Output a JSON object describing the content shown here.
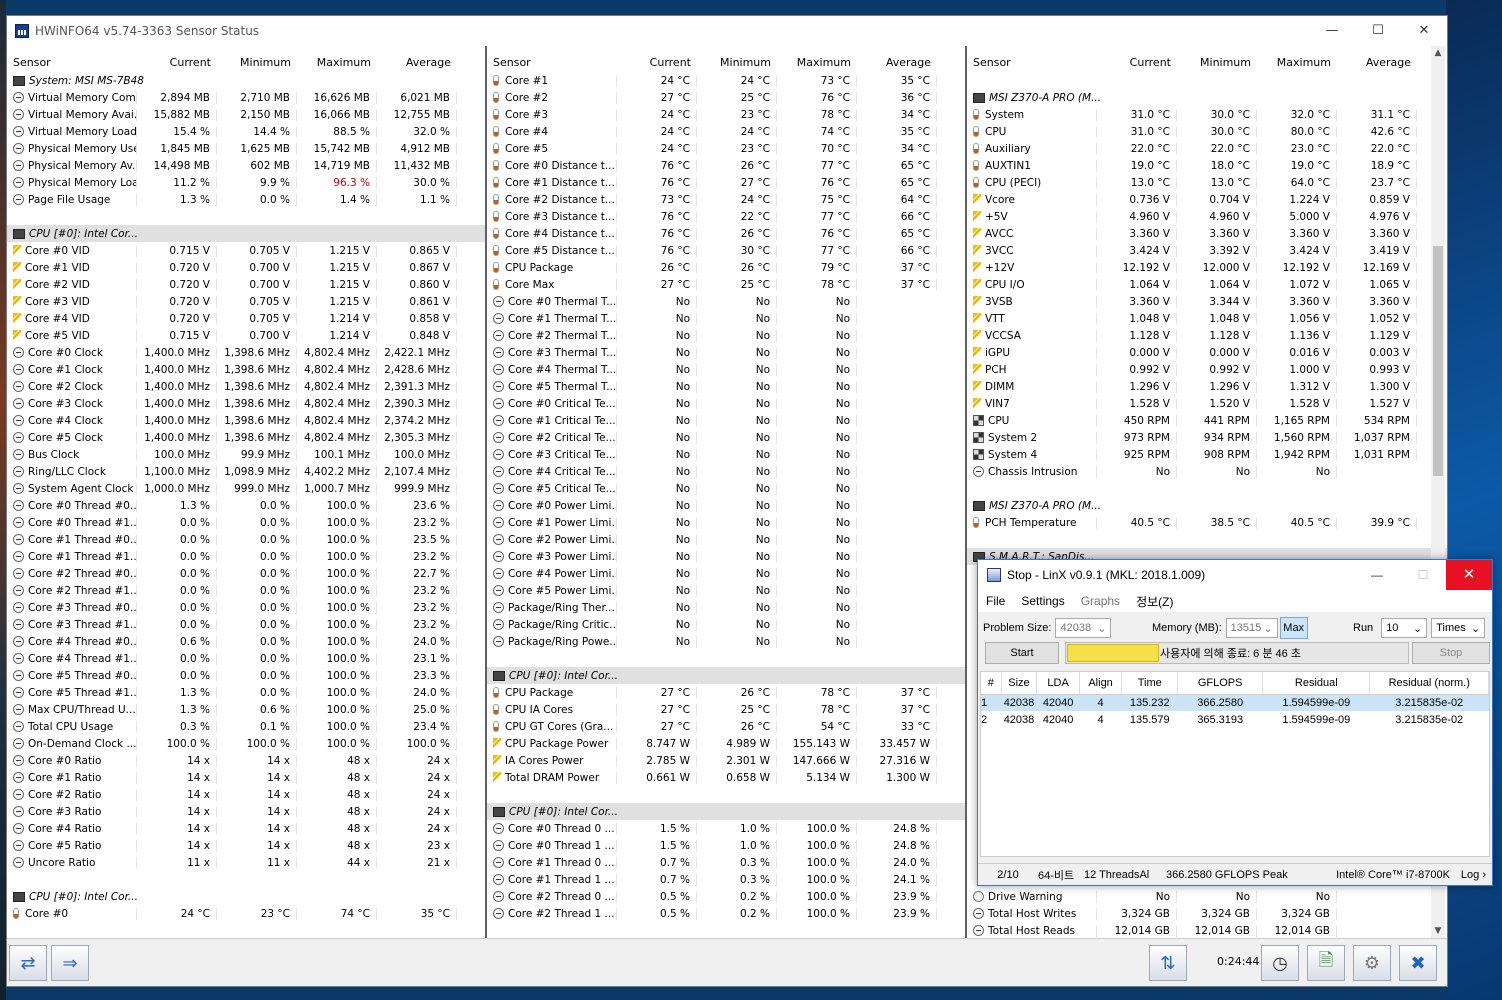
{
  "window": {
    "title": "HWiNFO64 v5.74-3363 Sensor Status",
    "timer": "0:24:44"
  },
  "colors": {
    "group_bg": "#e0e0e0",
    "alert_red": "#d00000",
    "linx_close": "#e81123",
    "progress": "#f5e04a"
  },
  "columns": {
    "sensor": "Sensor",
    "current": "Current",
    "minimum": "Minimum",
    "maximum": "Maximum",
    "average": "Average"
  },
  "panel1": [
    {
      "g": "System: MSI MS-7B48"
    },
    {
      "i": "clock",
      "n": "Virtual Memory Com...",
      "c": "2,894 MB",
      "mi": "2,710 MB",
      "ma": "16,626 MB",
      "a": "6,021 MB"
    },
    {
      "i": "clock",
      "n": "Virtual Memory Avai...",
      "c": "15,882 MB",
      "mi": "2,150 MB",
      "ma": "16,066 MB",
      "a": "12,755 MB"
    },
    {
      "i": "clock",
      "n": "Virtual Memory Load",
      "c": "15.4 %",
      "mi": "14.4 %",
      "ma": "88.5 %",
      "a": "32.0 %"
    },
    {
      "i": "clock",
      "n": "Physical Memory Used",
      "c": "1,845 MB",
      "mi": "1,625 MB",
      "ma": "15,742 MB",
      "a": "4,912 MB"
    },
    {
      "i": "clock",
      "n": "Physical Memory Av...",
      "c": "14,498 MB",
      "mi": "602 MB",
      "ma": "14,719 MB",
      "a": "11,432 MB"
    },
    {
      "i": "clock",
      "n": "Physical Memory Load",
      "c": "11.2 %",
      "mi": "9.9 %",
      "ma": "96.3 %",
      "a": "30.0 %",
      "red": true
    },
    {
      "i": "clock",
      "n": "Page File Usage",
      "c": "1.3 %",
      "mi": "0.0 %",
      "ma": "1.4 %",
      "a": "1.1 %"
    },
    {
      "gap": true
    },
    {
      "g": "CPU [#0]: Intel Cor..."
    },
    {
      "i": "volt",
      "n": "Core #0 VID",
      "c": "0.715 V",
      "mi": "0.705 V",
      "ma": "1.215 V",
      "a": "0.865 V"
    },
    {
      "i": "volt",
      "n": "Core #1 VID",
      "c": "0.720 V",
      "mi": "0.700 V",
      "ma": "1.215 V",
      "a": "0.867 V"
    },
    {
      "i": "volt",
      "n": "Core #2 VID",
      "c": "0.720 V",
      "mi": "0.700 V",
      "ma": "1.215 V",
      "a": "0.860 V"
    },
    {
      "i": "volt",
      "n": "Core #3 VID",
      "c": "0.720 V",
      "mi": "0.705 V",
      "ma": "1.215 V",
      "a": "0.861 V"
    },
    {
      "i": "volt",
      "n": "Core #4 VID",
      "c": "0.720 V",
      "mi": "0.705 V",
      "ma": "1.214 V",
      "a": "0.858 V"
    },
    {
      "i": "volt",
      "n": "Core #5 VID",
      "c": "0.715 V",
      "mi": "0.700 V",
      "ma": "1.214 V",
      "a": "0.848 V"
    },
    {
      "i": "clock",
      "n": "Core #0 Clock",
      "c": "1,400.0 MHz",
      "mi": "1,398.6 MHz",
      "ma": "4,802.4 MHz",
      "a": "2,422.1 MHz"
    },
    {
      "i": "clock",
      "n": "Core #1 Clock",
      "c": "1,400.0 MHz",
      "mi": "1,398.6 MHz",
      "ma": "4,802.4 MHz",
      "a": "2,428.6 MHz"
    },
    {
      "i": "clock",
      "n": "Core #2 Clock",
      "c": "1,400.0 MHz",
      "mi": "1,398.6 MHz",
      "ma": "4,802.4 MHz",
      "a": "2,391.3 MHz"
    },
    {
      "i": "clock",
      "n": "Core #3 Clock",
      "c": "1,400.0 MHz",
      "mi": "1,398.6 MHz",
      "ma": "4,802.4 MHz",
      "a": "2,390.3 MHz"
    },
    {
      "i": "clock",
      "n": "Core #4 Clock",
      "c": "1,400.0 MHz",
      "mi": "1,398.6 MHz",
      "ma": "4,802.4 MHz",
      "a": "2,374.2 MHz"
    },
    {
      "i": "clock",
      "n": "Core #5 Clock",
      "c": "1,400.0 MHz",
      "mi": "1,398.6 MHz",
      "ma": "4,802.4 MHz",
      "a": "2,305.3 MHz"
    },
    {
      "i": "clock",
      "n": "Bus Clock",
      "c": "100.0 MHz",
      "mi": "99.9 MHz",
      "ma": "100.1 MHz",
      "a": "100.0 MHz"
    },
    {
      "i": "clock",
      "n": "Ring/LLC Clock",
      "c": "1,100.0 MHz",
      "mi": "1,098.9 MHz",
      "ma": "4,402.2 MHz",
      "a": "2,107.4 MHz"
    },
    {
      "i": "clock",
      "n": "System Agent Clock",
      "c": "1,000.0 MHz",
      "mi": "999.0 MHz",
      "ma": "1,000.7 MHz",
      "a": "999.9 MHz"
    },
    {
      "i": "clock",
      "n": "Core #0 Thread #0...",
      "c": "1.3 %",
      "mi": "0.0 %",
      "ma": "100.0 %",
      "a": "23.6 %"
    },
    {
      "i": "clock",
      "n": "Core #0 Thread #1...",
      "c": "0.0 %",
      "mi": "0.0 %",
      "ma": "100.0 %",
      "a": "23.2 %"
    },
    {
      "i": "clock",
      "n": "Core #1 Thread #0...",
      "c": "0.0 %",
      "mi": "0.0 %",
      "ma": "100.0 %",
      "a": "23.5 %"
    },
    {
      "i": "clock",
      "n": "Core #1 Thread #1...",
      "c": "0.0 %",
      "mi": "0.0 %",
      "ma": "100.0 %",
      "a": "23.2 %"
    },
    {
      "i": "clock",
      "n": "Core #2 Thread #0...",
      "c": "0.0 %",
      "mi": "0.0 %",
      "ma": "100.0 %",
      "a": "22.7 %"
    },
    {
      "i": "clock",
      "n": "Core #2 Thread #1...",
      "c": "0.0 %",
      "mi": "0.0 %",
      "ma": "100.0 %",
      "a": "23.2 %"
    },
    {
      "i": "clock",
      "n": "Core #3 Thread #0...",
      "c": "0.0 %",
      "mi": "0.0 %",
      "ma": "100.0 %",
      "a": "23.2 %"
    },
    {
      "i": "clock",
      "n": "Core #3 Thread #1...",
      "c": "0.0 %",
      "mi": "0.0 %",
      "ma": "100.0 %",
      "a": "23.2 %"
    },
    {
      "i": "clock",
      "n": "Core #4 Thread #0...",
      "c": "0.6 %",
      "mi": "0.0 %",
      "ma": "100.0 %",
      "a": "24.0 %"
    },
    {
      "i": "clock",
      "n": "Core #4 Thread #1...",
      "c": "0.0 %",
      "mi": "0.0 %",
      "ma": "100.0 %",
      "a": "23.1 %"
    },
    {
      "i": "clock",
      "n": "Core #5 Thread #0...",
      "c": "0.0 %",
      "mi": "0.0 %",
      "ma": "100.0 %",
      "a": "23.3 %"
    },
    {
      "i": "clock",
      "n": "Core #5 Thread #1...",
      "c": "1.3 %",
      "mi": "0.0 %",
      "ma": "100.0 %",
      "a": "24.0 %"
    },
    {
      "i": "clock",
      "n": "Max CPU/Thread U...",
      "c": "1.3 %",
      "mi": "0.6 %",
      "ma": "100.0 %",
      "a": "25.0 %"
    },
    {
      "i": "clock",
      "n": "Total CPU Usage",
      "c": "0.3 %",
      "mi": "0.1 %",
      "ma": "100.0 %",
      "a": "23.4 %"
    },
    {
      "i": "clock",
      "n": "On-Demand Clock ...",
      "c": "100.0 %",
      "mi": "100.0 %",
      "ma": "100.0 %",
      "a": "100.0 %"
    },
    {
      "i": "clock",
      "n": "Core #0 Ratio",
      "c": "14 x",
      "mi": "14 x",
      "ma": "48 x",
      "a": "24 x"
    },
    {
      "i": "clock",
      "n": "Core #1 Ratio",
      "c": "14 x",
      "mi": "14 x",
      "ma": "48 x",
      "a": "24 x"
    },
    {
      "i": "clock",
      "n": "Core #2 Ratio",
      "c": "14 x",
      "mi": "14 x",
      "ma": "48 x",
      "a": "24 x"
    },
    {
      "i": "clock",
      "n": "Core #3 Ratio",
      "c": "14 x",
      "mi": "14 x",
      "ma": "48 x",
      "a": "24 x"
    },
    {
      "i": "clock",
      "n": "Core #4 Ratio",
      "c": "14 x",
      "mi": "14 x",
      "ma": "48 x",
      "a": "24 x"
    },
    {
      "i": "clock",
      "n": "Core #5 Ratio",
      "c": "14 x",
      "mi": "14 x",
      "ma": "48 x",
      "a": "23 x"
    },
    {
      "i": "clock",
      "n": "Uncore Ratio",
      "c": "11 x",
      "mi": "11 x",
      "ma": "44 x",
      "a": "21 x"
    },
    {
      "gap": true
    },
    {
      "g": "CPU [#0]: Intel Cor..."
    },
    {
      "i": "temp",
      "n": "Core #0",
      "c": "24 °C",
      "mi": "23 °C",
      "ma": "74 °C",
      "a": "35 °C"
    }
  ],
  "panel2": [
    {
      "i": "temp",
      "n": "Core #1",
      "c": "24 °C",
      "mi": "24 °C",
      "ma": "73 °C",
      "a": "35 °C"
    },
    {
      "i": "temp",
      "n": "Core #2",
      "c": "27 °C",
      "mi": "25 °C",
      "ma": "76 °C",
      "a": "36 °C"
    },
    {
      "i": "temp",
      "n": "Core #3",
      "c": "24 °C",
      "mi": "23 °C",
      "ma": "78 °C",
      "a": "34 °C"
    },
    {
      "i": "temp",
      "n": "Core #4",
      "c": "24 °C",
      "mi": "24 °C",
      "ma": "74 °C",
      "a": "35 °C"
    },
    {
      "i": "temp",
      "n": "Core #5",
      "c": "24 °C",
      "mi": "23 °C",
      "ma": "70 °C",
      "a": "34 °C"
    },
    {
      "i": "temp",
      "n": "Core #0 Distance t...",
      "c": "76 °C",
      "mi": "26 °C",
      "ma": "77 °C",
      "a": "65 °C"
    },
    {
      "i": "temp",
      "n": "Core #1 Distance t...",
      "c": "76 °C",
      "mi": "27 °C",
      "ma": "76 °C",
      "a": "65 °C"
    },
    {
      "i": "temp",
      "n": "Core #2 Distance t...",
      "c": "73 °C",
      "mi": "24 °C",
      "ma": "75 °C",
      "a": "64 °C"
    },
    {
      "i": "temp",
      "n": "Core #3 Distance t...",
      "c": "76 °C",
      "mi": "22 °C",
      "ma": "77 °C",
      "a": "66 °C"
    },
    {
      "i": "temp",
      "n": "Core #4 Distance t...",
      "c": "76 °C",
      "mi": "26 °C",
      "ma": "76 °C",
      "a": "65 °C"
    },
    {
      "i": "temp",
      "n": "Core #5 Distance t...",
      "c": "76 °C",
      "mi": "30 °C",
      "ma": "77 °C",
      "a": "66 °C"
    },
    {
      "i": "temp",
      "n": "CPU Package",
      "c": "26 °C",
      "mi": "26 °C",
      "ma": "79 °C",
      "a": "37 °C"
    },
    {
      "i": "temp",
      "n": "Core Max",
      "c": "27 °C",
      "mi": "25 °C",
      "ma": "78 °C",
      "a": "37 °C"
    },
    {
      "i": "clock",
      "n": "Core #0 Thermal T...",
      "c": "No",
      "mi": "No",
      "ma": "No",
      "a": ""
    },
    {
      "i": "clock",
      "n": "Core #1 Thermal T...",
      "c": "No",
      "mi": "No",
      "ma": "No",
      "a": ""
    },
    {
      "i": "clock",
      "n": "Core #2 Thermal T...",
      "c": "No",
      "mi": "No",
      "ma": "No",
      "a": ""
    },
    {
      "i": "clock",
      "n": "Core #3 Thermal T...",
      "c": "No",
      "mi": "No",
      "ma": "No",
      "a": ""
    },
    {
      "i": "clock",
      "n": "Core #4 Thermal T...",
      "c": "No",
      "mi": "No",
      "ma": "No",
      "a": ""
    },
    {
      "i": "clock",
      "n": "Core #5 Thermal T...",
      "c": "No",
      "mi": "No",
      "ma": "No",
      "a": ""
    },
    {
      "i": "clock",
      "n": "Core #0 Critical Te...",
      "c": "No",
      "mi": "No",
      "ma": "No",
      "a": ""
    },
    {
      "i": "clock",
      "n": "Core #1 Critical Te...",
      "c": "No",
      "mi": "No",
      "ma": "No",
      "a": ""
    },
    {
      "i": "clock",
      "n": "Core #2 Critical Te...",
      "c": "No",
      "mi": "No",
      "ma": "No",
      "a": ""
    },
    {
      "i": "clock",
      "n": "Core #3 Critical Te...",
      "c": "No",
      "mi": "No",
      "ma": "No",
      "a": ""
    },
    {
      "i": "clock",
      "n": "Core #4 Critical Te...",
      "c": "No",
      "mi": "No",
      "ma": "No",
      "a": ""
    },
    {
      "i": "clock",
      "n": "Core #5 Critical Te...",
      "c": "No",
      "mi": "No",
      "ma": "No",
      "a": ""
    },
    {
      "i": "clock",
      "n": "Core #0 Power Limi...",
      "c": "No",
      "mi": "No",
      "ma": "No",
      "a": ""
    },
    {
      "i": "clock",
      "n": "Core #1 Power Limi...",
      "c": "No",
      "mi": "No",
      "ma": "No",
      "a": ""
    },
    {
      "i": "clock",
      "n": "Core #2 Power Limi...",
      "c": "No",
      "mi": "No",
      "ma": "No",
      "a": ""
    },
    {
      "i": "clock",
      "n": "Core #3 Power Limi...",
      "c": "No",
      "mi": "No",
      "ma": "No",
      "a": ""
    },
    {
      "i": "clock",
      "n": "Core #4 Power Limi...",
      "c": "No",
      "mi": "No",
      "ma": "No",
      "a": ""
    },
    {
      "i": "clock",
      "n": "Core #5 Power Limi...",
      "c": "No",
      "mi": "No",
      "ma": "No",
      "a": ""
    },
    {
      "i": "clock",
      "n": "Package/Ring Ther...",
      "c": "No",
      "mi": "No",
      "ma": "No",
      "a": ""
    },
    {
      "i": "clock",
      "n": "Package/Ring Critic...",
      "c": "No",
      "mi": "No",
      "ma": "No",
      "a": ""
    },
    {
      "i": "clock",
      "n": "Package/Ring Powe...",
      "c": "No",
      "mi": "No",
      "ma": "No",
      "a": ""
    },
    {
      "gap": true
    },
    {
      "g": "CPU [#0]: Intel Cor..."
    },
    {
      "i": "temp",
      "n": "CPU Package",
      "c": "27 °C",
      "mi": "26 °C",
      "ma": "78 °C",
      "a": "37 °C"
    },
    {
      "i": "temp",
      "n": "CPU IA Cores",
      "c": "27 °C",
      "mi": "25 °C",
      "ma": "78 °C",
      "a": "37 °C"
    },
    {
      "i": "temp",
      "n": "CPU GT Cores (Gra...",
      "c": "27 °C",
      "mi": "26 °C",
      "ma": "54 °C",
      "a": "33 °C"
    },
    {
      "i": "volt",
      "n": "CPU Package Power",
      "c": "8.747 W",
      "mi": "4.989 W",
      "ma": "155.143 W",
      "a": "33.457 W"
    },
    {
      "i": "volt",
      "n": "IA Cores Power",
      "c": "2.785 W",
      "mi": "2.301 W",
      "ma": "147.666 W",
      "a": "27.316 W"
    },
    {
      "i": "volt",
      "n": "Total DRAM Power",
      "c": "0.661 W",
      "mi": "0.658 W",
      "ma": "5.134 W",
      "a": "1.300 W"
    },
    {
      "gap": true
    },
    {
      "g": "CPU [#0]: Intel Cor..."
    },
    {
      "i": "clock",
      "n": "Core #0 Thread 0 ...",
      "c": "1.5 %",
      "mi": "1.0 %",
      "ma": "100.0 %",
      "a": "24.8 %"
    },
    {
      "i": "clock",
      "n": "Core #0 Thread 1 ...",
      "c": "1.5 %",
      "mi": "1.0 %",
      "ma": "100.0 %",
      "a": "24.8 %"
    },
    {
      "i": "clock",
      "n": "Core #1 Thread 0 ...",
      "c": "0.7 %",
      "mi": "0.3 %",
      "ma": "100.0 %",
      "a": "24.0 %"
    },
    {
      "i": "clock",
      "n": "Core #1 Thread 1 ...",
      "c": "0.7 %",
      "mi": "0.3 %",
      "ma": "100.0 %",
      "a": "24.1 %"
    },
    {
      "i": "clock",
      "n": "Core #2 Thread 0 ...",
      "c": "0.5 %",
      "mi": "0.2 %",
      "ma": "100.0 %",
      "a": "23.9 %"
    },
    {
      "i": "clock",
      "n": "Core #2 Thread 1 ...",
      "c": "0.5 %",
      "mi": "0.2 %",
      "ma": "100.0 %",
      "a": "23.9 %"
    }
  ],
  "panel3": [
    {
      "gap": true
    },
    {
      "g": "MSI Z370-A PRO (M..."
    },
    {
      "i": "temp",
      "n": "System",
      "c": "31.0 °C",
      "mi": "30.0 °C",
      "ma": "32.0 °C",
      "a": "31.1 °C"
    },
    {
      "i": "temp",
      "n": "CPU",
      "c": "31.0 °C",
      "mi": "30.0 °C",
      "ma": "80.0 °C",
      "a": "42.6 °C"
    },
    {
      "i": "temp",
      "n": "Auxiliary",
      "c": "22.0 °C",
      "mi": "22.0 °C",
      "ma": "23.0 °C",
      "a": "22.0 °C"
    },
    {
      "i": "temp",
      "n": "AUXTIN1",
      "c": "19.0 °C",
      "mi": "18.0 °C",
      "ma": "19.0 °C",
      "a": "18.9 °C"
    },
    {
      "i": "temp",
      "n": "CPU (PECI)",
      "c": "13.0 °C",
      "mi": "13.0 °C",
      "ma": "64.0 °C",
      "a": "23.7 °C"
    },
    {
      "i": "volt",
      "n": "Vcore",
      "c": "0.736 V",
      "mi": "0.704 V",
      "ma": "1.224 V",
      "a": "0.859 V"
    },
    {
      "i": "volt",
      "n": "+5V",
      "c": "4.960 V",
      "mi": "4.960 V",
      "ma": "5.000 V",
      "a": "4.976 V"
    },
    {
      "i": "volt",
      "n": "AVCC",
      "c": "3.360 V",
      "mi": "3.360 V",
      "ma": "3.360 V",
      "a": "3.360 V"
    },
    {
      "i": "volt",
      "n": "3VCC",
      "c": "3.424 V",
      "mi": "3.392 V",
      "ma": "3.424 V",
      "a": "3.419 V"
    },
    {
      "i": "volt",
      "n": "+12V",
      "c": "12.192 V",
      "mi": "12.000 V",
      "ma": "12.192 V",
      "a": "12.169 V"
    },
    {
      "i": "volt",
      "n": "CPU I/O",
      "c": "1.064 V",
      "mi": "1.064 V",
      "ma": "1.072 V",
      "a": "1.065 V"
    },
    {
      "i": "volt",
      "n": "3VSB",
      "c": "3.360 V",
      "mi": "3.344 V",
      "ma": "3.360 V",
      "a": "3.360 V"
    },
    {
      "i": "volt",
      "n": "VTT",
      "c": "1.048 V",
      "mi": "1.048 V",
      "ma": "1.056 V",
      "a": "1.052 V"
    },
    {
      "i": "volt",
      "n": "VCCSA",
      "c": "1.128 V",
      "mi": "1.128 V",
      "ma": "1.136 V",
      "a": "1.129 V"
    },
    {
      "i": "volt",
      "n": "iGPU",
      "c": "0.000 V",
      "mi": "0.000 V",
      "ma": "0.016 V",
      "a": "0.003 V"
    },
    {
      "i": "volt",
      "n": "PCH",
      "c": "0.992 V",
      "mi": "0.992 V",
      "ma": "1.000 V",
      "a": "0.993 V"
    },
    {
      "i": "volt",
      "n": "DIMM",
      "c": "1.296 V",
      "mi": "1.296 V",
      "ma": "1.312 V",
      "a": "1.300 V"
    },
    {
      "i": "volt",
      "n": "VIN7",
      "c": "1.528 V",
      "mi": "1.520 V",
      "ma": "1.528 V",
      "a": "1.527 V"
    },
    {
      "i": "fan",
      "n": "CPU",
      "c": "450 RPM",
      "mi": "441 RPM",
      "ma": "1,165 RPM",
      "a": "534 RPM"
    },
    {
      "i": "fan",
      "n": "System 2",
      "c": "973 RPM",
      "mi": "934 RPM",
      "ma": "1,560 RPM",
      "a": "1,037 RPM"
    },
    {
      "i": "fan",
      "n": "System 4",
      "c": "925 RPM",
      "mi": "908 RPM",
      "ma": "1,942 RPM",
      "a": "1,031 RPM"
    },
    {
      "i": "clock",
      "n": "Chassis Intrusion",
      "c": "No",
      "mi": "No",
      "ma": "No",
      "a": ""
    },
    {
      "gap": true
    },
    {
      "g": "MSI Z370-A PRO (M..."
    },
    {
      "i": "temp",
      "n": "PCH Temperature",
      "c": "40.5 °C",
      "mi": "38.5 °C",
      "ma": "40.5 °C",
      "a": "39.9 °C"
    },
    {
      "gap": true
    },
    {
      "g": "S.M.A.R.T.: SanDis..."
    }
  ],
  "panel3_bottom": [
    {
      "i": "warn",
      "n": "Drive Warning",
      "c": "No",
      "mi": "No",
      "ma": "No",
      "a": ""
    },
    {
      "i": "clock",
      "n": "Total Host Writes",
      "c": "3,324 GB",
      "mi": "3,324 GB",
      "ma": "3,324 GB",
      "a": ""
    },
    {
      "i": "clock",
      "n": "Total Host Reads",
      "c": "12,014 GB",
      "mi": "12,014 GB",
      "ma": "12,014 GB",
      "a": ""
    }
  ],
  "linx": {
    "title": "Stop - LinX v0.9.1 (MKL: 2018.1.009)",
    "menu": [
      "File",
      "Settings",
      "Graphs",
      "정보(Z)"
    ],
    "problem_size_label": "Problem Size:",
    "problem_size": "42038",
    "memory_label": "Memory (MB):",
    "memory": "13515",
    "max_label": "Max",
    "run_label": "Run",
    "run_value": "10",
    "run_unit": "Times",
    "start_label": "Start",
    "stop_label": "Stop",
    "status_message": "사용자에 의해 종료: 6 분 46 초",
    "progress_fraction": 0.27,
    "table_headers": [
      "#",
      "Size",
      "LDA",
      "Align",
      "Time",
      "GFLOPS",
      "Residual",
      "Residual (norm.)"
    ],
    "rows": [
      [
        "1",
        "42038",
        "42040",
        "4",
        "135.232",
        "366.2580",
        "1.594599e-09",
        "3.215835e-02"
      ],
      [
        "2",
        "42038",
        "42040",
        "4",
        "135.579",
        "365.3193",
        "1.594599e-09",
        "3.215835e-02"
      ]
    ],
    "status_bar": {
      "progress": "2/10",
      "bits": "64-비트",
      "threads": "12 ThreadsAl",
      "peak": "366.2580 GFLOPS Peak",
      "cpu": "Intel® Core™ i7-8700K",
      "log": "Log ›"
    }
  }
}
